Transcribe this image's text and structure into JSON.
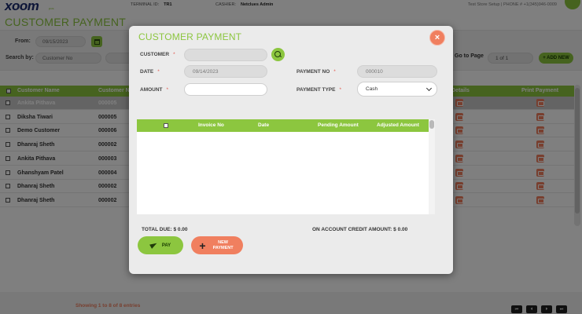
{
  "topbar": {
    "logo": "xoom",
    "logo_sub": "pos",
    "terminal_label": "TERMINAL ID:",
    "terminal_value": "TR1",
    "cashier_label": "CASHIER:",
    "cashier_value": "Netclues Admin",
    "store_info": "Test Store Setup | PHONE # +1(345)946-0009"
  },
  "page": {
    "title": "CUSTOMER PAYMENT"
  },
  "filters": {
    "from_label": "From:",
    "from_value": "09/15/2023",
    "search_by_label": "Search by:",
    "search_by_value": "Customer No",
    "goto_label": "Go to Page",
    "page_value": "1 of 1",
    "add_new": "+ ADD NEW"
  },
  "table": {
    "headers": {
      "customer_name": "Customer Name",
      "customer_no": "Customer N",
      "details": "Details",
      "print_payment": "Print Payment"
    },
    "rows": [
      {
        "name": "Ankita Pithava",
        "no": "000005",
        "highlighted": true
      },
      {
        "name": "Diksha Tiwari",
        "no": "000005",
        "highlighted": false
      },
      {
        "name": "Demo Customer",
        "no": "000006",
        "highlighted": false
      },
      {
        "name": "Dhanraj Sheth",
        "no": "000002",
        "highlighted": false
      },
      {
        "name": "Ankita Pithava",
        "no": "000003",
        "highlighted": false
      },
      {
        "name": "Ghanshyam Patel",
        "no": "000004",
        "highlighted": false
      },
      {
        "name": "Dhanraj Sheth",
        "no": "000002",
        "highlighted": false
      },
      {
        "name": "Dhanraj Sheth",
        "no": "000002",
        "highlighted": false
      }
    ]
  },
  "footer": {
    "showing": "Showing 1 to 8 of 8 entries",
    "pager": [
      "⏮",
      "⏴",
      "⏵",
      "⏭"
    ]
  },
  "modal": {
    "title": "CUSTOMER PAYMENT",
    "close": "×",
    "required_mark": "*",
    "customer_label": "CUSTOMER",
    "customer_value": "",
    "date_label": "DATE",
    "date_value": "09/14/2023",
    "amount_label": "AMOUNT",
    "amount_value": "",
    "payment_no_label": "PAYMENT NO",
    "payment_no_value": "000010",
    "payment_type_label": "PAYMENT TYPE",
    "payment_type_value": "Cash",
    "grid_headers": {
      "invoice_no": "Invoice No",
      "date": "Date",
      "pending_amount": "Pending Amount",
      "adjusted_amount": "Adjusted Amount"
    },
    "total_due_label": "TOTAL DUE:",
    "total_due_value": "$ 0.00",
    "credit_label": "ON ACCOUNT CREDIT AMOUNT:",
    "credit_value": "$ 0.00",
    "pay_button": "PAY",
    "new_payment_button_line1": "NEW",
    "new_payment_button_line2": "PAYMENT"
  },
  "colors": {
    "accent_green": "#8cc63f",
    "accent_salmon": "#f07f5f",
    "required_red": "#e2584d"
  }
}
